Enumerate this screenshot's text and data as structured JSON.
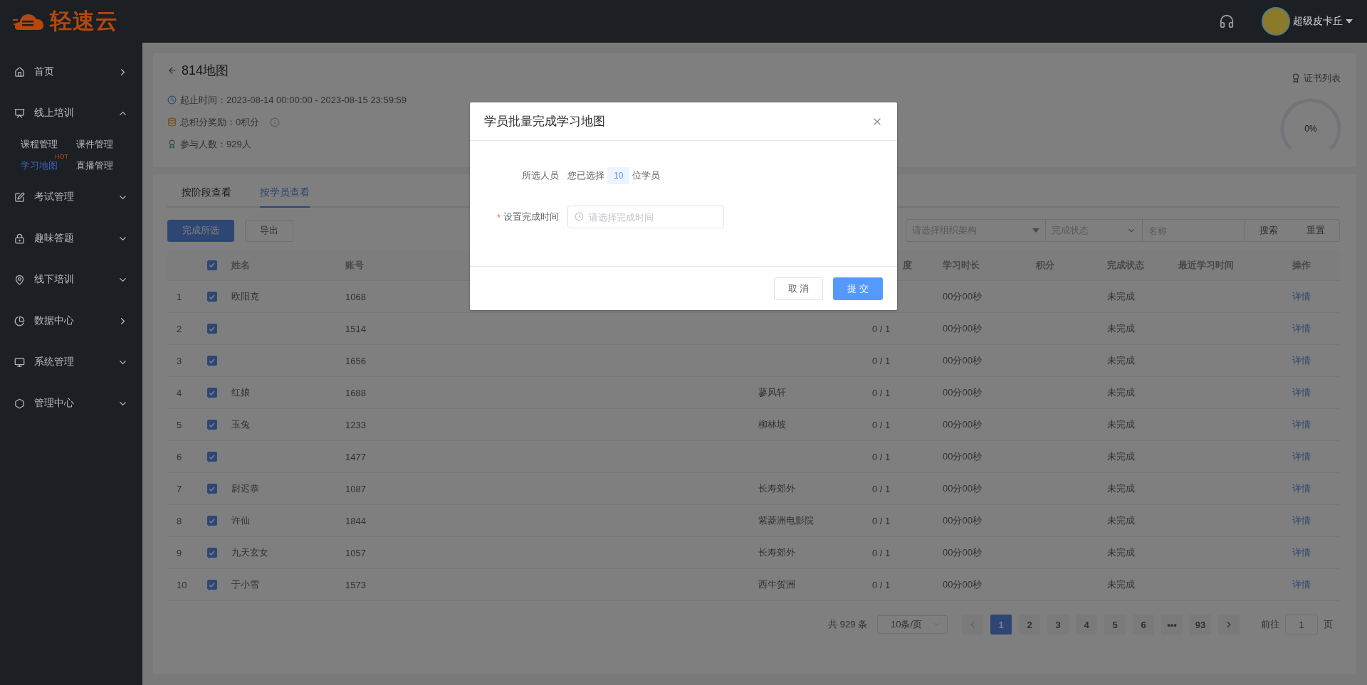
{
  "header": {
    "logo_text": "轻速云",
    "user_name": "超级皮卡丘"
  },
  "sidebar": {
    "items": [
      {
        "label": "首页",
        "kind": "link"
      },
      {
        "label": "线上培训",
        "kind": "group",
        "expanded": true,
        "children": [
          {
            "label": "课程管理",
            "selected": false
          },
          {
            "label": "课件管理",
            "selected": false
          },
          {
            "label": "学习地图",
            "selected": true,
            "badge": "HOT"
          },
          {
            "label": "直播管理",
            "selected": false
          }
        ]
      },
      {
        "label": "考试管理",
        "kind": "group",
        "expanded": false
      },
      {
        "label": "趣味答题",
        "kind": "group",
        "expanded": false
      },
      {
        "label": "线下培训",
        "kind": "group",
        "expanded": false
      },
      {
        "label": "数据中心",
        "kind": "link"
      },
      {
        "label": "系统管理",
        "kind": "group",
        "expanded": false
      },
      {
        "label": "管理中心",
        "kind": "group",
        "expanded": false
      }
    ]
  },
  "summary": {
    "title": "814地图",
    "info": [
      {
        "kind": "time",
        "text": "起止时间：2023-08-14 00:00:00 - 2023-08-15 23:59:59"
      },
      {
        "kind": "points",
        "text": "总积分奖励：0积分"
      },
      {
        "kind": "people",
        "text": "参与人数：929人"
      }
    ],
    "certificate_link": "证书列表",
    "progress": {
      "reading": "0%"
    }
  },
  "tabs": [
    {
      "label": "按阶段查看",
      "selected": false
    },
    {
      "label": "按学员查看",
      "selected": true
    }
  ],
  "actions": [
    {
      "label": "完成所选",
      "kind": "primary"
    },
    {
      "label": "导出",
      "kind": "default"
    }
  ],
  "filters": {
    "org_placeholder": "请选择组织架构",
    "status_placeholder": "完成状态",
    "name_placeholder": "名称",
    "buttons": [
      "搜索",
      "重置"
    ]
  },
  "table": {
    "columns": [
      {
        "kind": "index"
      },
      {
        "kind": "checkbox",
        "checked": true
      },
      {
        "kind": "text",
        "label": "姓名"
      },
      {
        "kind": "text",
        "label": "账号"
      },
      {
        "kind": "text"
      },
      {
        "kind": "text",
        "label": "度"
      },
      {
        "kind": "text",
        "label": "学习时长"
      },
      {
        "kind": "text",
        "label": "积分"
      },
      {
        "kind": "text",
        "label": "完成状态"
      },
      {
        "kind": "text",
        "label": "最近学习时间"
      },
      {
        "kind": "text",
        "label": "操作"
      }
    ],
    "rows": [
      {
        "index": "1",
        "checked": true,
        "name": "欧阳克",
        "account": "1068",
        "duration": "00分00秒",
        "status": "未完成",
        "action": "详情"
      },
      {
        "index": "2",
        "checked": true,
        "account": "1514",
        "progress": "0 / 1",
        "duration": "00分00秒",
        "status": "未完成",
        "action": "详情"
      },
      {
        "index": "3",
        "checked": true,
        "account": "1656",
        "progress": "0 / 1",
        "duration": "00分00秒",
        "status": "未完成",
        "action": "详情"
      },
      {
        "index": "4",
        "checked": true,
        "name": "红娘",
        "account": "1688",
        "column_5": "蓼风轩",
        "progress": "0 / 1",
        "duration": "00分00秒",
        "status": "未完成",
        "action": "详情"
      },
      {
        "index": "5",
        "checked": true,
        "name": "玉兔",
        "account": "1233",
        "column_5": "柳林坡",
        "progress": "0 / 1",
        "duration": "00分00秒",
        "status": "未完成",
        "action": "详情"
      },
      {
        "index": "6",
        "checked": true,
        "account": "1477",
        "progress": "0 / 1",
        "duration": "00分00秒",
        "status": "未完成",
        "action": "详情"
      },
      {
        "index": "7",
        "checked": true,
        "name": "尉迟恭",
        "account": "1087",
        "column_5": "长寿郊外",
        "progress": "0 / 1",
        "duration": "00分00秒",
        "status": "未完成",
        "action": "详情"
      },
      {
        "index": "8",
        "checked": true,
        "name": "许仙",
        "account": "1844",
        "column_5": "紫菱洲电影院",
        "progress": "0 / 1",
        "duration": "00分00秒",
        "status": "未完成",
        "action": "详情"
      },
      {
        "index": "9",
        "checked": true,
        "name": "九天玄女",
        "account": "1057",
        "column_5": "长寿郊外",
        "progress": "0 / 1",
        "duration": "00分00秒",
        "status": "未完成",
        "action": "详情"
      },
      {
        "index": "10",
        "checked": true,
        "name": "于小雪",
        "account": "1573",
        "column_5": "西牛贺洲",
        "progress": "0 / 1",
        "duration": "00分00秒",
        "status": "未完成",
        "action": "详情"
      }
    ]
  },
  "pagination": {
    "total": "共 929 条",
    "page_size": "10条/页",
    "pages": [
      {
        "label": "1",
        "selected": true
      },
      {
        "label": "2",
        "selected": false
      },
      {
        "label": "3",
        "selected": false
      },
      {
        "label": "4",
        "selected": false
      },
      {
        "label": "5",
        "selected": false
      },
      {
        "label": "6",
        "selected": false
      },
      {
        "label": "•••",
        "selected": false
      },
      {
        "label": "93",
        "selected": false
      }
    ],
    "goto_label": "前往",
    "goto_value": "1",
    "goto_suffix": "页"
  },
  "dialog": {
    "title": "学员批量完成学习地图",
    "fields": [
      {
        "kind": "count",
        "label": "所选人员",
        "prefix": "您已选择",
        "count": "10",
        "suffix": "位学员"
      },
      {
        "kind": "time",
        "label": "设置完成时间",
        "required_mark": "*",
        "placeholder": "请选择完成时间"
      }
    ],
    "buttons": [
      {
        "label": "取 消",
        "kind": "default"
      },
      {
        "label": "提 交",
        "kind": "primary"
      }
    ]
  }
}
